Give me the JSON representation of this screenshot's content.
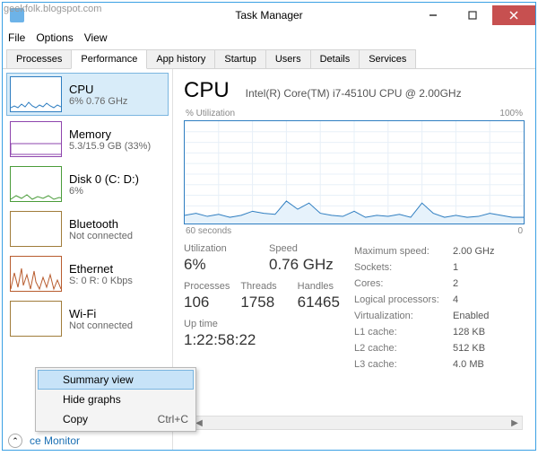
{
  "watermark": "geekfolk.blogspot.com",
  "window": {
    "title": "Task Manager"
  },
  "menubar": [
    "File",
    "Options",
    "View"
  ],
  "tabs": [
    "Processes",
    "Performance",
    "App history",
    "Startup",
    "Users",
    "Details",
    "Services"
  ],
  "active_tab": 1,
  "sidebar": [
    {
      "title": "CPU",
      "sub": "6% 0.76 GHz",
      "color": "#2f7ec1",
      "selected": true
    },
    {
      "title": "Memory",
      "sub": "5.3/15.9 GB (33%)",
      "color": "#8e44ad",
      "selected": false
    },
    {
      "title": "Disk 0 (C: D:)",
      "sub": "6%",
      "color": "#4a9c3a",
      "selected": false
    },
    {
      "title": "Bluetooth",
      "sub": "Not connected",
      "color": "#a07c3a",
      "selected": false
    },
    {
      "title": "Ethernet",
      "sub": "S: 0 R: 0 Kbps",
      "color": "#b85c2e",
      "selected": false
    },
    {
      "title": "Wi-Fi",
      "sub": "Not connected",
      "color": "#a07c3a",
      "selected": false
    }
  ],
  "main": {
    "title": "CPU",
    "subtitle": "Intel(R) Core(TM) i7-4510U CPU @ 2.00GHz",
    "chart_top_left": "% Utilization",
    "chart_top_right": "100%",
    "chart_bottom_left": "60 seconds",
    "chart_bottom_right": "0",
    "stats1": [
      {
        "label": "Utilization",
        "value": "6%"
      },
      {
        "label": "Speed",
        "value": "0.76 GHz"
      }
    ],
    "stats2": [
      {
        "label": "Processes",
        "value": "106"
      },
      {
        "label": "Threads",
        "value": "1758"
      },
      {
        "label": "Handles",
        "value": "61465"
      }
    ],
    "uptime_label": "Up time",
    "uptime_value": "1:22:58:22",
    "kv": [
      {
        "k": "Maximum speed:",
        "v": "2.00 GHz"
      },
      {
        "k": "Sockets:",
        "v": "1"
      },
      {
        "k": "Cores:",
        "v": "2"
      },
      {
        "k": "Logical processors:",
        "v": "4"
      },
      {
        "k": "Virtualization:",
        "v": "Enabled"
      },
      {
        "k": "L1 cache:",
        "v": "128 KB"
      },
      {
        "k": "L2 cache:",
        "v": "512 KB"
      },
      {
        "k": "L3 cache:",
        "v": "4.0 MB"
      }
    ]
  },
  "context_menu": [
    {
      "label": "Summary view",
      "shortcut": "",
      "highlighted": true
    },
    {
      "label": "Hide graphs",
      "shortcut": "",
      "highlighted": false
    },
    {
      "label": "Copy",
      "shortcut": "Ctrl+C",
      "highlighted": false
    }
  ],
  "footer_link": "ce Monitor",
  "chart_data": {
    "type": "line",
    "title": "% Utilization",
    "xlabel": "60 seconds",
    "ylabel": "% Utilization",
    "ylim": [
      0,
      100
    ],
    "x": [
      0,
      2,
      4,
      6,
      8,
      10,
      12,
      14,
      16,
      18,
      20,
      22,
      24,
      26,
      28,
      30,
      32,
      34,
      36,
      38,
      40,
      42,
      44,
      46,
      48,
      50,
      52,
      54,
      56,
      58,
      60
    ],
    "values": [
      8,
      10,
      7,
      9,
      6,
      8,
      12,
      10,
      9,
      22,
      14,
      20,
      10,
      8,
      7,
      12,
      6,
      8,
      7,
      9,
      6,
      20,
      10,
      6,
      8,
      6,
      7,
      10,
      8,
      6,
      6
    ]
  }
}
